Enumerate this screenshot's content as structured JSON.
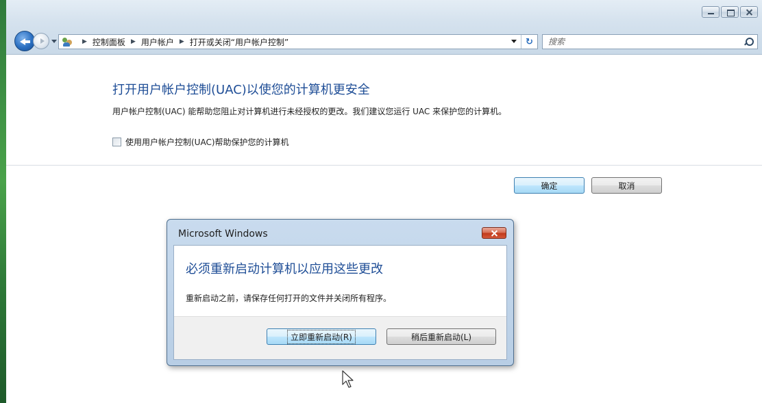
{
  "window": {
    "breadcrumbs": [
      "控制面板",
      "用户帐户",
      "打开或关闭“用户帐户控制”"
    ],
    "search_placeholder": "搜索"
  },
  "main": {
    "title": "打开用户帐户控制(UAC)以使您的计算机更安全",
    "description": "用户帐户控制(UAC) 能帮助您阻止对计算机进行未经授权的更改。我们建议您运行 UAC 来保护您的计算机。",
    "uac_checkbox_label": "使用用户帐户控制(UAC)帮助保护您的计算机",
    "uac_checked": false,
    "ok_label": "确定",
    "cancel_label": "取消"
  },
  "dialog": {
    "title": "Microsoft Windows",
    "heading": "必须重新启动计算机以应用这些更改",
    "message": "重新启动之前，请保存任何打开的文件并关闭所有程序。",
    "restart_now_label": "立即重新启动(R)",
    "restart_later_label": "稍后重新启动(L)"
  },
  "colors": {
    "heading_blue": "#1e4d96",
    "frame": "#d5e2ee",
    "close_red": "#c0391a"
  }
}
